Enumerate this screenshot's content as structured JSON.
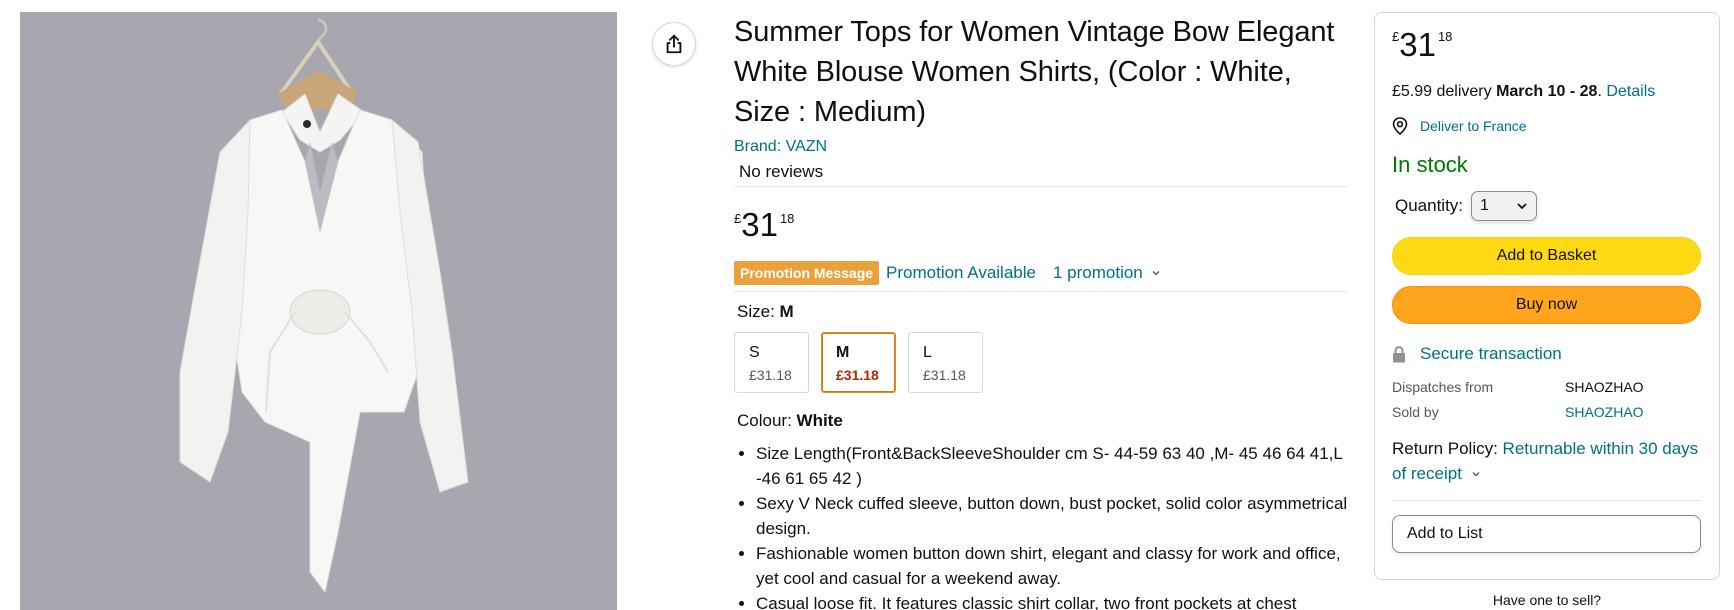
{
  "product": {
    "title": "Summer Tops for Women Vintage Bow Elegant White Blouse Women Shirts, (Color : White, Size : Medium)",
    "brand": "Brand: VAZN",
    "reviews": "No reviews",
    "price": {
      "symbol": "£",
      "whole": "31",
      "fraction": "18"
    }
  },
  "promotion": {
    "badge": "Promotion Message",
    "link": "Promotion Available",
    "count": "1 promotion"
  },
  "size": {
    "label": "Size: ",
    "selected": "M",
    "options": [
      {
        "size": "S",
        "price": "£31.18"
      },
      {
        "size": "M",
        "price": "£31.18"
      },
      {
        "size": "L",
        "price": "£31.18"
      }
    ]
  },
  "colour": {
    "label": "Colour: ",
    "selected": "White"
  },
  "bullets": [
    "Size Length(Front&BackSleeveShoulder cm S- 44-59 63 40 ,M- 45 46 64 41,L -46 61 65 42 )",
    "Sexy V Neck cuffed sleeve, button down, bust pocket, solid color asymmetrical design.",
    "Fashionable women button down shirt, elegant and classy for work and office, yet cool and casual for a weekend away.",
    "Casual loose fit. It features classic shirt collar, two front pockets at chest"
  ],
  "buybox": {
    "price": {
      "symbol": "£",
      "whole": "31",
      "fraction": "18"
    },
    "delivery_fee": "£5.99 delivery ",
    "delivery_dates": "March 10 - 28",
    "delivery_sep": ". ",
    "details": "Details",
    "deliver_to": "Deliver to France",
    "stock": "In stock",
    "quantity_label": "Quantity:",
    "quantity_value": "1",
    "add_to_basket": "Add to Basket",
    "buy_now": "Buy now",
    "secure": "Secure transaction",
    "dispatches_label": "Dispatches from",
    "dispatches_value": "SHAOZHAO",
    "sold_label": "Sold by",
    "sold_value": "SHAOZHAO",
    "return_label": "Return Policy: ",
    "return_value": "Returnable within 30 days of receipt",
    "add_to_list": "Add to List",
    "have_one": "Have one to sell?"
  },
  "icons": {
    "share": "share-icon",
    "location": "location-pin-icon",
    "lock": "lock-icon",
    "chevron": "chevron-down-icon"
  },
  "colors": {
    "link": "#007185",
    "stock": "#007600",
    "basket": "#ffd814",
    "buy_now": "#ffa41c",
    "promo_badge": "#e9a23b",
    "selected_price": "#b12704"
  }
}
